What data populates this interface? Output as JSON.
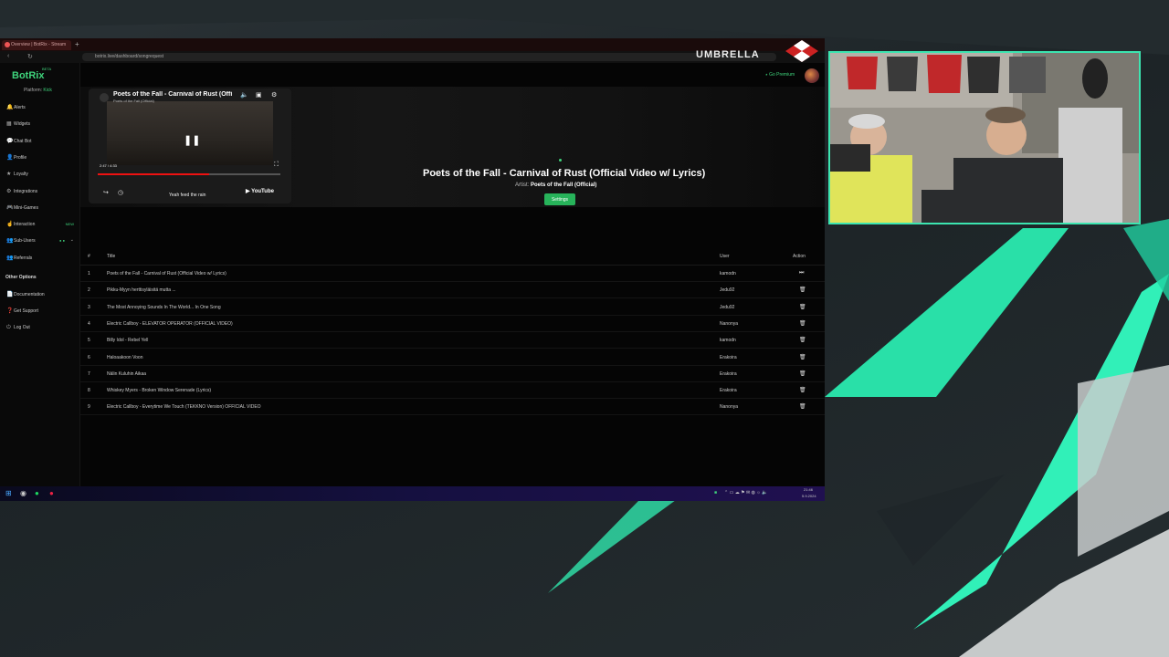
{
  "browser": {
    "tab_title": "Overview | BotRix - Stream",
    "new_tab": "+",
    "url": "botrix.live/dashboard/songrequest",
    "back": "‹",
    "reload": "↻"
  },
  "overlay": {
    "umbrella_text": "UMBRELLA"
  },
  "app": {
    "brand": "BotRix",
    "beta": "BETA",
    "platform_label": "Platform:",
    "platform_value": "Kick",
    "go_premium": "Go Premium",
    "sidebar": [
      {
        "label": "Alerts",
        "icon": "bell-icon",
        "glyph": "🔔"
      },
      {
        "label": "Widgets",
        "icon": "widget-icon",
        "glyph": "▦"
      },
      {
        "label": "Chat Bot",
        "icon": "chat-icon",
        "glyph": "💬"
      },
      {
        "label": "Profile",
        "icon": "user-icon",
        "glyph": "👤"
      },
      {
        "label": "Loyalty",
        "icon": "star-icon",
        "glyph": "★"
      },
      {
        "label": "Integrations",
        "icon": "plug-icon",
        "glyph": "⚙"
      },
      {
        "label": "Mini-Games",
        "icon": "gamepad-icon",
        "glyph": "🎮"
      },
      {
        "label": "Interaction",
        "icon": "hand-icon",
        "glyph": "☝",
        "badge": "NEW"
      },
      {
        "label": "Sub-Users",
        "icon": "users-icon",
        "glyph": "👥",
        "badge": "● ●",
        "chevron": "⌄"
      },
      {
        "label": "Referrals",
        "icon": "people-icon",
        "glyph": "👥"
      }
    ],
    "other_heading": "Other Options",
    "other": [
      {
        "label": "Documentation",
        "icon": "doc-icon",
        "glyph": "📄"
      },
      {
        "label": "Get Support",
        "icon": "support-icon",
        "glyph": "❓"
      },
      {
        "label": "Log Out",
        "icon": "logout-icon",
        "glyph": "⏻"
      }
    ]
  },
  "player": {
    "video_title": "Poets of the Fall - Carnival of Rust (Offi",
    "video_channel": "Poets of the Fall (Official)",
    "time": "2:47 / 4:33",
    "progress": 0.61,
    "lyric": "Yeah feed the rain",
    "youtube": "▶ YouTube",
    "title": "Poets of the Fall - Carnival of Rust (Official Video w/ Lyrics)",
    "artist_label": "Artist:",
    "artist": "Poets of the Fall (Official)",
    "settings": "Settings"
  },
  "queue": {
    "headers": {
      "num": "#",
      "title": "Title",
      "user": "User",
      "action": "Action"
    },
    "rows": [
      {
        "num": "1",
        "title": "Poets of the Fall - Carnival of Rust (Official Video w/ Lyrics)",
        "user": "kamodn",
        "action": "⏭"
      },
      {
        "num": "2",
        "title": "Pikku-Myyn herttisyläisitä mutta ...",
        "user": "Jedu92",
        "action": "🗑"
      },
      {
        "num": "3",
        "title": "The Most Annoying Sounds In The World... In One Song",
        "user": "Jedu92",
        "action": "🗑"
      },
      {
        "num": "4",
        "title": "Electric Callboy - ELEVATOR OPERATOR (OFFICIAL VIDEO)",
        "user": "Nanonya",
        "action": "🗑"
      },
      {
        "num": "5",
        "title": "Billy Idol - Rebel Yell",
        "user": "kamodn",
        "action": "🗑"
      },
      {
        "num": "6",
        "title": "Haloaakoon Voon",
        "user": "Erakoira",
        "action": "🗑"
      },
      {
        "num": "7",
        "title": "Nälin Kuluhin Aikaa",
        "user": "Erakoira",
        "action": "🗑"
      },
      {
        "num": "8",
        "title": "Whiskey Myers - Broken Window Serenade (Lyrics)",
        "user": "Erakoira",
        "action": "🗑"
      },
      {
        "num": "9",
        "title": "Electric Callboy - Everytime We Touch (TEKKNO Version) OFFICIAL VIDEO",
        "user": "Nanonya",
        "action": "🗑"
      }
    ]
  },
  "taskbar": {
    "start_glyph": "⊞",
    "tray_time": "21:46",
    "tray_date": "5.9.2024"
  },
  "colors": {
    "accent": "#3fd47c",
    "webcam_border": "#3ce5b0",
    "settings_button": "#27b35a",
    "youtube_progress": "#e11111"
  }
}
